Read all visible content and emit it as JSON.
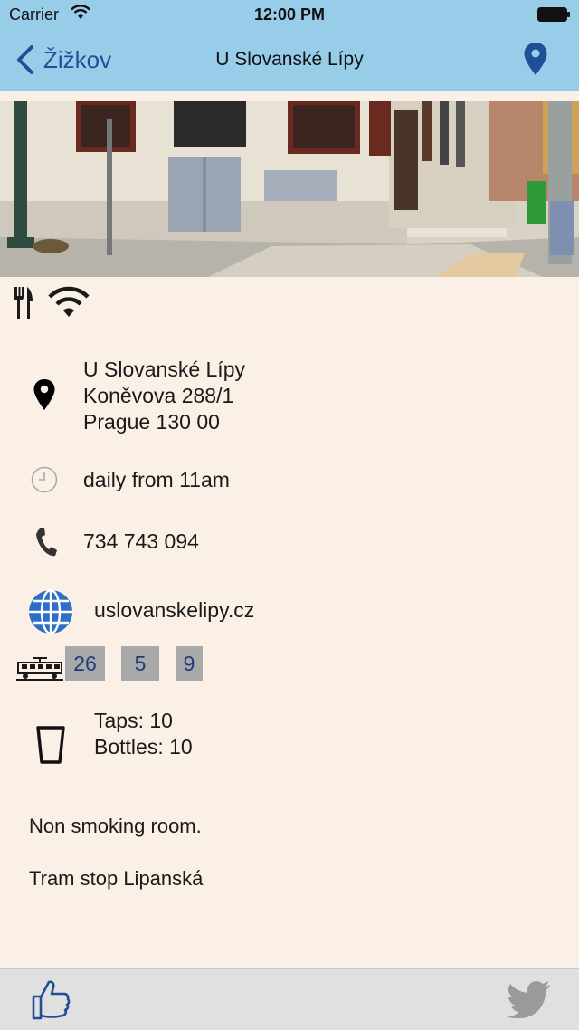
{
  "status_bar": {
    "carrier": "Carrier",
    "time": "12:00 PM"
  },
  "nav": {
    "back_label": "Žižkov",
    "title": "U Slovanské Lípy"
  },
  "address": {
    "name": "U Slovanské Lípy",
    "street": "Koněvova 288/1",
    "city": "Prague 130 00"
  },
  "hours": "daily from 11am",
  "phone": "734 743 094",
  "website": "uslovanskelipy.cz",
  "trams": [
    "26",
    "5",
    "9"
  ],
  "beer": {
    "taps": "Taps: 10",
    "bottles": "Bottles: 10"
  },
  "notes": [
    "Non smoking room.",
    "Tram stop Lipanská"
  ],
  "colors": {
    "nav_bg": "#97cde9",
    "accent": "#1f4f97",
    "page_bg": "#faf0e6",
    "badge_bg": "#a9a9a9"
  },
  "icons": [
    "wifi-icon",
    "battery-icon",
    "back-chevron-icon",
    "map-pin-icon",
    "cutlery-icon",
    "wifi-amenity-icon",
    "location-pin-icon",
    "clock-icon",
    "phone-icon",
    "globe-icon",
    "tram-icon",
    "glass-icon",
    "thumbs-up-icon",
    "twitter-icon"
  ]
}
